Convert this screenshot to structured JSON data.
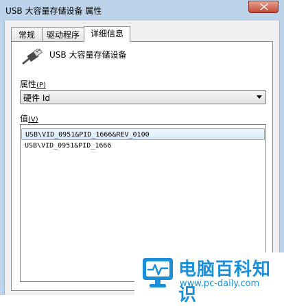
{
  "window": {
    "title": "USB 大容量存储设备 属性"
  },
  "tabs": [
    {
      "label": "常规"
    },
    {
      "label": "驱动程序"
    },
    {
      "label": "详细信息",
      "active": true
    }
  ],
  "device": {
    "name": "USB 大容量存储设备",
    "icon": "usb-plug-icon"
  },
  "property": {
    "label": "属性",
    "accel": "(P)",
    "selected": "硬件 Id"
  },
  "value": {
    "label": "值",
    "accel": "(V)",
    "items": [
      "USB\\VID_0951&PID_1666&REV_0100",
      "USB\\VID_0951&PID_1666"
    ],
    "selected_index": 0
  },
  "watermark": {
    "title": "电脑百科知识",
    "url": "www.pc-daily.com"
  },
  "colors": {
    "brand": "#1b8fd8",
    "selection_border": "#84acdd"
  }
}
